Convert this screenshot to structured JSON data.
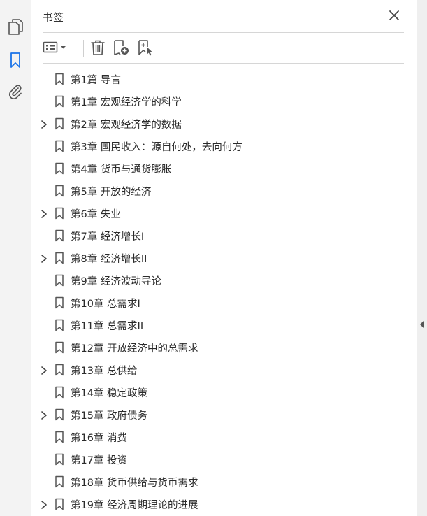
{
  "panel": {
    "title": "书签"
  },
  "rail": {
    "icons": [
      "pages-icon",
      "bookmark-icon",
      "attachment-icon"
    ],
    "active": "bookmark-icon"
  },
  "toolbar": {
    "icons": [
      "options-menu-icon",
      "delete-icon",
      "new-bookmark-icon",
      "bookmark-from-selection-icon"
    ]
  },
  "colors": {
    "accent": "#1a73e8",
    "text": "#2b2b2b",
    "icon": "#555555"
  },
  "bookmarks": [
    {
      "label": "第1篇  导言",
      "expandable": false
    },
    {
      "label": "第1章  宏观经济学的科学",
      "expandable": false
    },
    {
      "label": "第2章  宏观经济学的数据",
      "expandable": true
    },
    {
      "label": "第3章  国民收入：源自何处，去向何方",
      "expandable": false
    },
    {
      "label": "第4章  货币与通货膨胀",
      "expandable": false
    },
    {
      "label": "第5章  开放的经济",
      "expandable": false
    },
    {
      "label": "第6章  失业",
      "expandable": true
    },
    {
      "label": "第7章  经济增长I",
      "expandable": false
    },
    {
      "label": "第8章  经济增长II",
      "expandable": true
    },
    {
      "label": "第9章  经济波动导论",
      "expandable": false
    },
    {
      "label": "第10章  总需求I",
      "expandable": false
    },
    {
      "label": "第11章  总需求II",
      "expandable": false
    },
    {
      "label": "第12章  开放经济中的总需求",
      "expandable": false
    },
    {
      "label": "第13章  总供给",
      "expandable": true
    },
    {
      "label": "第14章  稳定政策",
      "expandable": false
    },
    {
      "label": "第15章  政府债务",
      "expandable": true
    },
    {
      "label": "第16章  消费",
      "expandable": false
    },
    {
      "label": "第17章  投资",
      "expandable": false
    },
    {
      "label": "第18章  货币供给与货币需求",
      "expandable": false
    },
    {
      "label": "第19章  经济周期理论的进展",
      "expandable": true
    }
  ]
}
